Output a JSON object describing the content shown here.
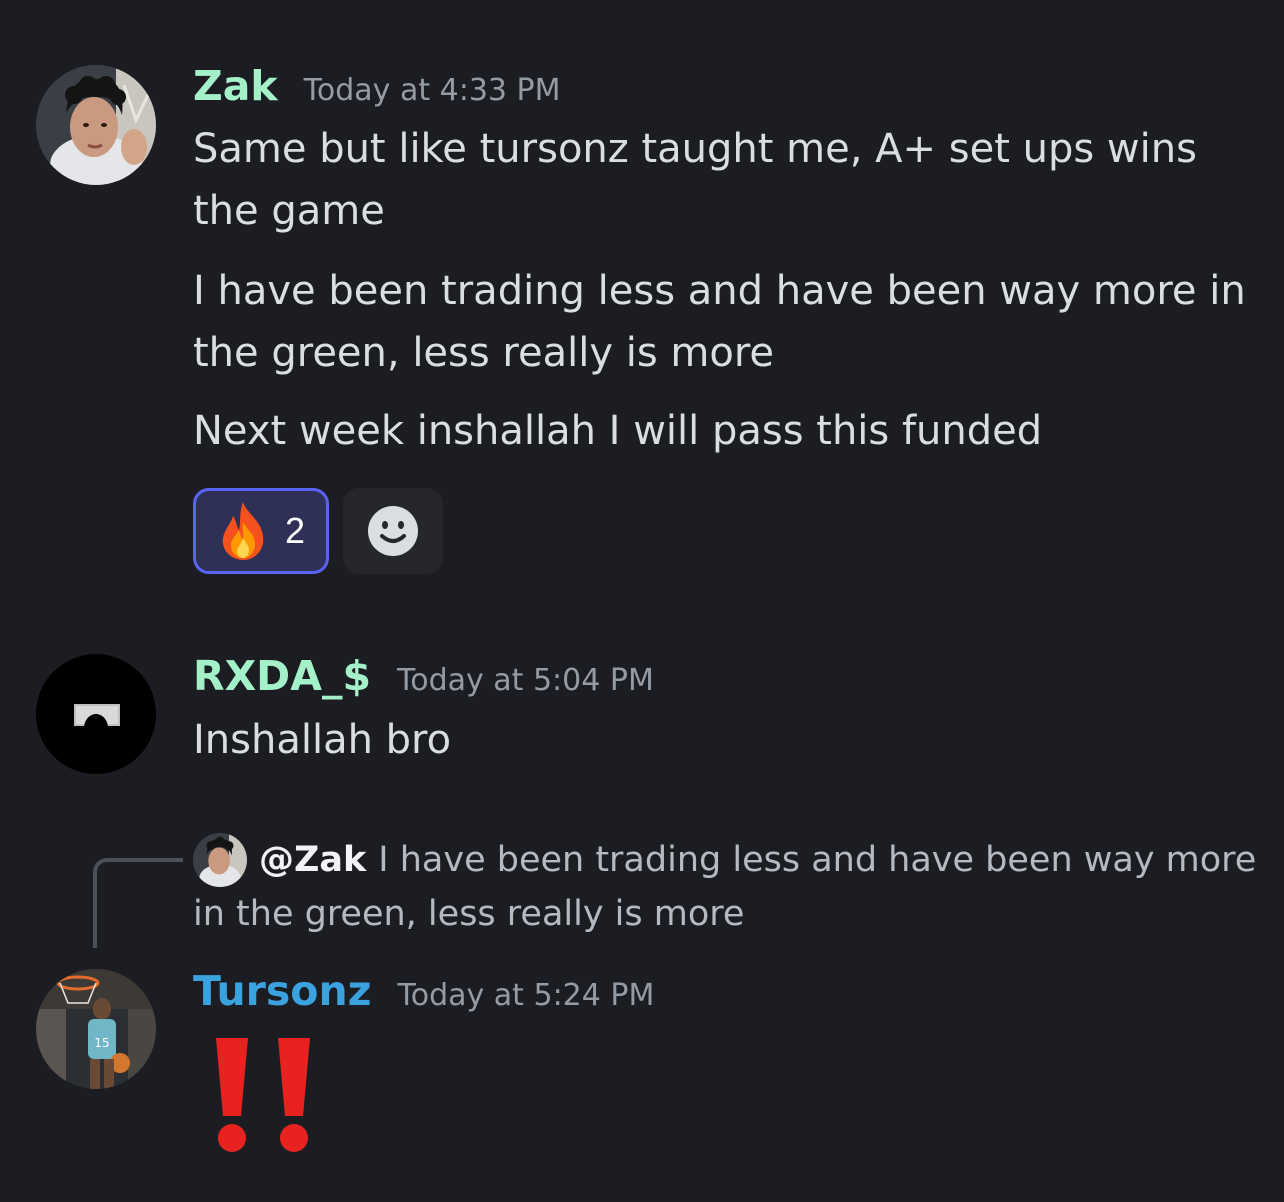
{
  "messages": [
    {
      "username": "Zak",
      "username_color": "#a3f0c9",
      "timestamp": "Today at 4:33 PM",
      "lines": [
        "Same but like tursonz taught me, A+ set ups wins the game",
        "I have been trading less and have been way more in the green, less really is more",
        "Next week inshallah I will pass this funded"
      ],
      "reactions": [
        {
          "emoji": "fire",
          "count": "2",
          "active": true
        }
      ],
      "add_reaction_icon": "smiley-icon"
    },
    {
      "username": "RXDA_$",
      "username_color": "#a3f0c9",
      "timestamp": "Today at 5:04 PM",
      "lines": [
        "Inshallah bro"
      ]
    },
    {
      "username": "Tursonz",
      "username_color": "#3ba2e0",
      "timestamp": "Today at 5:24 PM",
      "reply": {
        "mention": "@Zak",
        "text": "I have been trading less and have been way more in the green, less really is more"
      },
      "content_emoji": "double-exclamation"
    }
  ],
  "colors": {
    "background": "#1c1d22",
    "timestamp": "#949ba4",
    "reaction_active_border": "#5865f2",
    "exclamation_red": "#e8231f"
  }
}
